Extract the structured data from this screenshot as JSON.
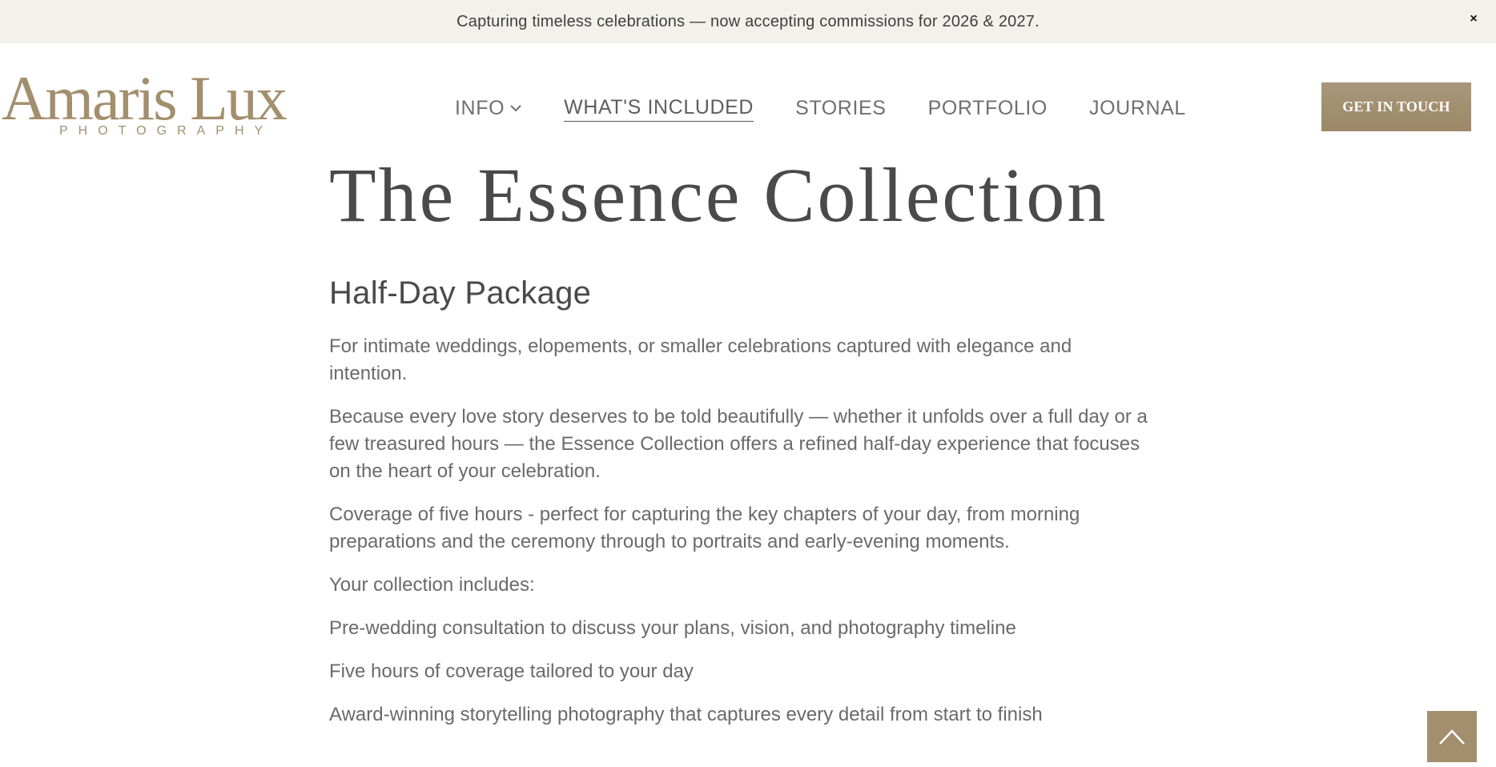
{
  "announcement": {
    "text": "Capturing timeless celebrations — now accepting commissions for 2026 & 2027.",
    "close_label": "×"
  },
  "header": {
    "logo_main": "Amaris Lux",
    "logo_sub": "PHOTOGRAPHY",
    "nav": [
      {
        "label": "INFO"
      },
      {
        "label": "WHAT'S INCLUDED"
      },
      {
        "label": "STORIES"
      },
      {
        "label": "PORTFOLIO"
      },
      {
        "label": "JOURNAL"
      }
    ],
    "cta_label": "GET IN TOUCH"
  },
  "main": {
    "title": "The Essence Collection",
    "subtitle": "Half-Day Package",
    "paragraphs": [
      "For intimate weddings, elopements, or smaller celebrations captured with elegance and intention.",
      "Because every love story deserves to be told beautifully — whether it unfolds over a full day or a few treasured hours — the Essence Collection offers a refined half-day experience that focuses on the heart of your celebration.",
      "Coverage of five hours - perfect for capturing the key chapters of your day, from morning preparations and the ceremony through to portraits and early-evening moments.",
      "Your collection includes:",
      "Pre-wedding consultation to discuss your plans, vision, and photography timeline",
      "Five hours of coverage tailored to your day",
      "Award-winning storytelling photography that captures every detail from start to finish"
    ]
  },
  "colors": {
    "accent": "#a38f6d",
    "announcement_bg": "#f2f1ec",
    "text": "#6a6a6a",
    "heading": "#4a4a4a"
  },
  "icons": {
    "close": "close-icon",
    "nav_dropdown": "chevron-down-icon",
    "back_to_top": "chevron-up-icon"
  }
}
